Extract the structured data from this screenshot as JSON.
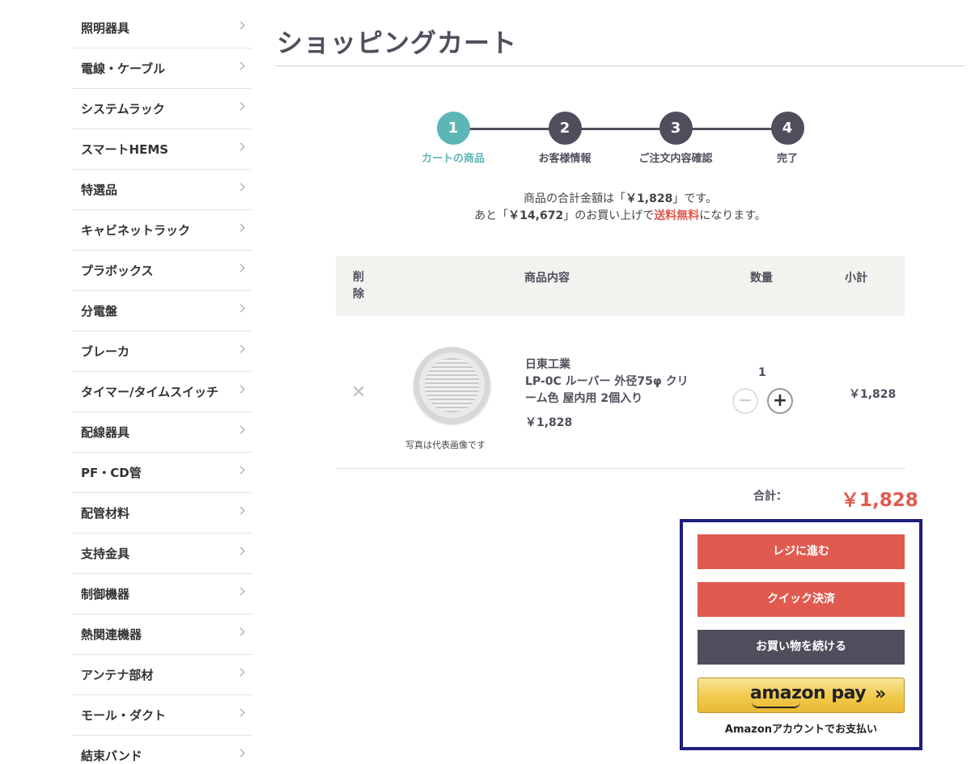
{
  "sidebar": {
    "items": [
      {
        "label": "照明器具"
      },
      {
        "label": "電線・ケーブル"
      },
      {
        "label": "システムラック"
      },
      {
        "label": "スマートHEMS"
      },
      {
        "label": "特選品"
      },
      {
        "label": "キャビネットラック"
      },
      {
        "label": "プラボックス"
      },
      {
        "label": "分電盤"
      },
      {
        "label": "ブレーカ"
      },
      {
        "label": "タイマー/タイムスイッチ"
      },
      {
        "label": "配線器具"
      },
      {
        "label": "PF・CD管"
      },
      {
        "label": "配管材料"
      },
      {
        "label": "支持金具"
      },
      {
        "label": "制御機器"
      },
      {
        "label": "熱関連機器"
      },
      {
        "label": "アンテナ部材"
      },
      {
        "label": "モール・ダクト"
      },
      {
        "label": "結束バンド"
      }
    ]
  },
  "page": {
    "title": "ショッピングカート"
  },
  "steps": [
    {
      "num": "1",
      "label": "カートの商品",
      "active": true
    },
    {
      "num": "2",
      "label": "お客様情報",
      "active": false
    },
    {
      "num": "3",
      "label": "ご注文内容確認",
      "active": false
    },
    {
      "num": "4",
      "label": "完了",
      "active": false
    }
  ],
  "summary": {
    "line1_pre": "商品の合計金額は「",
    "line1_amount": "￥1,828",
    "line1_post": "」です。",
    "line2_pre": "あと「",
    "line2_amount": "￥14,672",
    "line2_mid": "」のお買い上げで",
    "line2_free": "送料無料",
    "line2_post": "になります。"
  },
  "table": {
    "headers": {
      "delete": "削除",
      "item": "商品内容",
      "qty": "数量",
      "subtotal": "小計"
    },
    "rows": [
      {
        "delete_icon": "✕",
        "photo_note": "写真は代表画像です",
        "maker": "日東工業",
        "name": "LP-0C ルーバー 外径75φ クリーム色 屋内用 2個入り",
        "price": "￥1,828",
        "qty": "1",
        "subtotal": "￥1,828"
      }
    ]
  },
  "total": {
    "label": "合計：",
    "value": "￥1,828"
  },
  "actions": {
    "checkout": "レジに進む",
    "quick": "クイック決済",
    "continue": "お買い物を続ける",
    "amazon_logo": "amazon pay",
    "amazon_arrow": "»",
    "amazon_note": "Amazonアカウントでお支払い"
  },
  "colors": {
    "accent_red": "#e05a4f",
    "step_active": "#5cb6b6",
    "dark": "#4f4e5c",
    "highlight_border": "#1d1e7e"
  },
  "icons": {
    "sidebar_chevron": "chevron-right-icon",
    "delete": "close-icon",
    "minus": "minus-icon",
    "plus": "plus-icon"
  }
}
